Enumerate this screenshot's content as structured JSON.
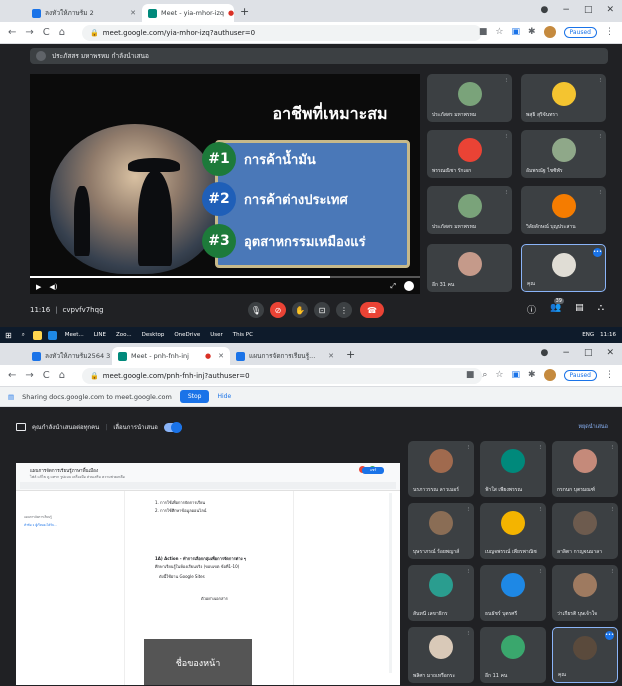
{
  "shot1": {
    "tabs": [
      {
        "label": "ลงทัวให้ภาษร้ม 2",
        "active": false,
        "favicon_color": "#1a73e8"
      },
      {
        "label": "Meet - yia-mhor-izq",
        "active": true,
        "favicon_color": "#00897b"
      }
    ],
    "new_tab": "+",
    "window_controls": [
      "●",
      "−",
      "□",
      "✕"
    ],
    "nav_icons": [
      "←",
      "→",
      "C",
      "⌂"
    ],
    "url": "meet.google.com/yia-mhor-izq?authuser=0",
    "paused_label": "Paused",
    "meeting_head": "ประภัสสร มหาพรหม กำลังนำเสนอ",
    "slide": {
      "title": "อาชีพที่เหมาะสม",
      "bullets": [
        {
          "number": "#1",
          "text": "การค้าน้ำมัน"
        },
        {
          "number": "#2",
          "text": "การค้าต่างประเทศ"
        },
        {
          "number": "#3",
          "text": "อุตสาหกรรมเหมืองแร่"
        }
      ],
      "video_progress": 0.77
    },
    "tiles": [
      {
        "name": "ประภัสสร มหาพรหม",
        "color": "#7aa37a",
        "selected": false
      },
      {
        "name": "พสุธิ สุริจันทรา",
        "color": "#f4c430",
        "selected": false
      },
      {
        "name": "พรรณณิชา รักเอก",
        "color": "#ea4335",
        "selected": false
      },
      {
        "name": "อัมพรณัฐ ไชซิพัร",
        "color": "#8fa889",
        "selected": false
      },
      {
        "name": "ประภัสสร มหาพรหม",
        "color": "#7aa37a",
        "selected": false
      },
      {
        "name": "วิลัยลักษณ์ บุญประสาน",
        "color": "#f57c00",
        "selected": false
      },
      {
        "name": "อีก 31 คน",
        "color": "#c59a8a",
        "selected": false
      },
      {
        "name": "คุณ",
        "color": "#e0ddd5",
        "selected": true
      }
    ],
    "meet_bar": {
      "time": "11:16",
      "code": "cvpvfv7hqg",
      "participant_count": "39"
    },
    "taskbar": {
      "items": [
        "Meet...",
        "LINE",
        "Zoo...",
        "Desktop",
        "OneDrive",
        "User",
        "This PC"
      ],
      "lang": "ENG",
      "clock": "11:16"
    }
  },
  "shot2": {
    "tabs": [
      {
        "label": "ลงทัวให้ภาษร้ม2564 3",
        "active": false,
        "favicon_color": "#1a73e8"
      },
      {
        "label": "Meet - pnh-fnh-inj",
        "active": true,
        "favicon_color": "#00897b"
      },
      {
        "label": "แผนการจัดการเรียนรู้...",
        "active": false,
        "favicon_color": "#1a73e8"
      }
    ],
    "new_tab": "+",
    "window_controls": [
      "●",
      "−",
      "□",
      "✕"
    ],
    "nav_icons": [
      "←",
      "→",
      "C",
      "⌂"
    ],
    "url": "meet.google.com/pnh-fnh-inj?authuser=0",
    "paused_label": "Paused",
    "share_bar": {
      "message": "Sharing docs.google.com to meet.google.com",
      "stop": "Stop",
      "hide": "Hide"
    },
    "presenting": {
      "label": "คุณกำลังนำเสนอต่อทุกคน",
      "pin_label": "เลื่อนการนำเสนอ",
      "link": "หยุดนำเสนอ"
    },
    "doc": {
      "title": "แผนการจัดการเรียนรู้ภาษาพื้นเมือง",
      "menu": "ไฟล์ แก้ไข ดู แทรก รูปแบบ เครื่องมือ ส่วนเสริม ความช่วยเหลือ",
      "share": "แชร์",
      "side": [
        "แผนการจัดการเรียนรู้",
        "หัวข้อ 1 ผู้เรียนจะได้รับ..."
      ],
      "lines": [
        "1. การใช้เพื่อการจัดการเรียน",
        "2. การใช้ศึกษาข้อมูลออนไลน์",
        "1A) Action - ทำการเลือกกลุ่มเพื่อการจัดการต่าง ๆ",
        "ศึกษาเรียนรู้ในห้องเรียนจริง (ขอบเขต ข้อที่1-10)",
        "ดังนี้ใช้ผ่าน Google Sites",
        "ตัวอย่างเอกสาร"
      ],
      "card": "ชื่อของหน้า"
    },
    "tiles": [
      {
        "name": "นรภาวรรณ ลาวเมอร์",
        "color": "#a06a4e",
        "selected": false
      },
      {
        "name": "ฟ้าใส เพียงพรรณ",
        "color": "#00897b",
        "selected": false
      },
      {
        "name": "กรกนก บุตรมณฑ์",
        "color": "#c58a7a",
        "selected": false
      },
      {
        "name": "บุษราภรณ์ ร้อยพญาส์",
        "color": "#8a6d55",
        "selected": false
      },
      {
        "name": "เบญจพรรณ์ เพียรพาณิช",
        "color": "#f4b400",
        "selected": false
      },
      {
        "name": "ลาลิตา กาญจนมาลา",
        "color": "#6d5b4e",
        "selected": false
      },
      {
        "name": "สันทนี เลขาธิกร",
        "color": "#2a9d8f",
        "selected": false
      },
      {
        "name": "ธนธัชร์ บุตรศรี",
        "color": "#1e88e5",
        "selected": false
      },
      {
        "name": "ว่าเกียรติ บุษเจ้าใจ",
        "color": "#9e7a60",
        "selected": false
      },
      {
        "name": "พลิศา มาถเหรือกระ",
        "color": "#d9c9b8",
        "selected": false
      },
      {
        "name": "อีก 11 คน",
        "color": "#3aa76d",
        "selected": false
      },
      {
        "name": "คุณ",
        "color": "#5a4a3c",
        "selected": true
      }
    ]
  }
}
